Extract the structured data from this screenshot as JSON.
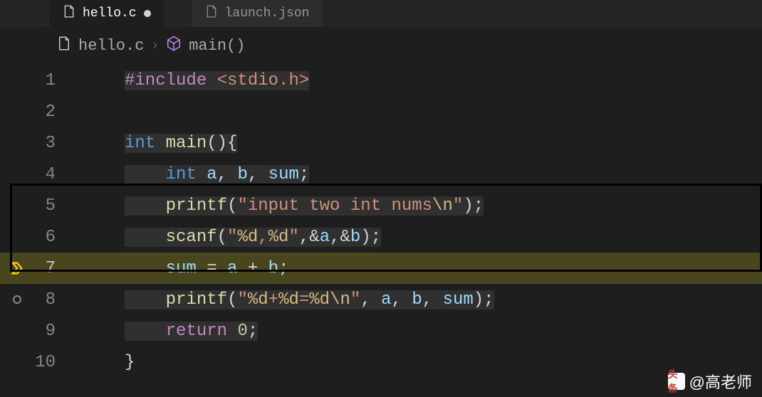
{
  "tabs": [
    {
      "name": "hello.c",
      "active": true,
      "modified": true
    },
    {
      "name": "launch.json",
      "active": false,
      "modified": false
    }
  ],
  "breadcrumbs": {
    "file": "hello.c",
    "symbol": "main()"
  },
  "lines": [
    {
      "num": "1",
      "tokens": [
        {
          "t": "#include",
          "c": "tok-pp"
        },
        {
          "t": " ",
          "c": ""
        },
        {
          "t": "<stdio.h>",
          "c": "tok-inc"
        }
      ]
    },
    {
      "num": "2",
      "tokens": []
    },
    {
      "num": "3",
      "tokens": [
        {
          "t": "int",
          "c": "tok-kw"
        },
        {
          "t": " ",
          "c": ""
        },
        {
          "t": "main",
          "c": "tok-fn"
        },
        {
          "t": "(){",
          "c": "tok-punc"
        }
      ]
    },
    {
      "num": "4",
      "tokens": [
        {
          "t": "    ",
          "c": ""
        },
        {
          "t": "int",
          "c": "tok-kw"
        },
        {
          "t": " ",
          "c": ""
        },
        {
          "t": "a",
          "c": "tok-var"
        },
        {
          "t": ", ",
          "c": "tok-punc"
        },
        {
          "t": "b",
          "c": "tok-var"
        },
        {
          "t": ", ",
          "c": "tok-punc"
        },
        {
          "t": "sum",
          "c": "tok-var"
        },
        {
          "t": ";",
          "c": "tok-punc"
        }
      ]
    },
    {
      "num": "5",
      "tokens": [
        {
          "t": "    ",
          "c": ""
        },
        {
          "t": "printf",
          "c": "tok-fn"
        },
        {
          "t": "(",
          "c": "tok-punc"
        },
        {
          "t": "\"input two int nums",
          "c": "tok-str"
        },
        {
          "t": "\\n",
          "c": "tok-esc"
        },
        {
          "t": "\"",
          "c": "tok-str"
        },
        {
          "t": ");",
          "c": "tok-punc"
        }
      ]
    },
    {
      "num": "6",
      "tokens": [
        {
          "t": "    ",
          "c": ""
        },
        {
          "t": "scanf",
          "c": "tok-fn"
        },
        {
          "t": "(",
          "c": "tok-punc"
        },
        {
          "t": "\"",
          "c": "tok-str"
        },
        {
          "t": "%d",
          "c": "tok-esc"
        },
        {
          "t": ",",
          "c": "tok-str"
        },
        {
          "t": "%d",
          "c": "tok-esc"
        },
        {
          "t": "\"",
          "c": "tok-str"
        },
        {
          "t": ",&",
          "c": "tok-punc"
        },
        {
          "t": "a",
          "c": "tok-var"
        },
        {
          "t": ",&",
          "c": "tok-punc"
        },
        {
          "t": "b",
          "c": "tok-var"
        },
        {
          "t": ");",
          "c": "tok-punc"
        }
      ]
    },
    {
      "num": "7",
      "current": true,
      "gutterIcon": "debug-current",
      "tokens": [
        {
          "t": "    ",
          "c": ""
        },
        {
          "t": "sum",
          "c": "tok-var"
        },
        {
          "t": " = ",
          "c": "tok-op"
        },
        {
          "t": "a",
          "c": "tok-var"
        },
        {
          "t": " + ",
          "c": "tok-op"
        },
        {
          "t": "b",
          "c": "tok-var"
        },
        {
          "t": ";",
          "c": "tok-punc"
        }
      ]
    },
    {
      "num": "8",
      "gutterIcon": "breakpoint-unverified",
      "tokens": [
        {
          "t": "    ",
          "c": ""
        },
        {
          "t": "printf",
          "c": "tok-fn"
        },
        {
          "t": "(",
          "c": "tok-punc"
        },
        {
          "t": "\"",
          "c": "tok-str"
        },
        {
          "t": "%d",
          "c": "tok-esc"
        },
        {
          "t": "+",
          "c": "tok-str"
        },
        {
          "t": "%d",
          "c": "tok-esc"
        },
        {
          "t": "=",
          "c": "tok-str"
        },
        {
          "t": "%d",
          "c": "tok-esc"
        },
        {
          "t": "\\n",
          "c": "tok-esc"
        },
        {
          "t": "\"",
          "c": "tok-str"
        },
        {
          "t": ", ",
          "c": "tok-punc"
        },
        {
          "t": "a",
          "c": "tok-var"
        },
        {
          "t": ", ",
          "c": "tok-punc"
        },
        {
          "t": "b",
          "c": "tok-var"
        },
        {
          "t": ", ",
          "c": "tok-punc"
        },
        {
          "t": "sum",
          "c": "tok-var"
        },
        {
          "t": ");",
          "c": "tok-punc"
        }
      ]
    },
    {
      "num": "9",
      "tokens": [
        {
          "t": "    ",
          "c": ""
        },
        {
          "t": "return",
          "c": "tok-pp"
        },
        {
          "t": " ",
          "c": ""
        },
        {
          "t": "0",
          "c": "tok-num"
        },
        {
          "t": ";",
          "c": "tok-punc"
        }
      ]
    },
    {
      "num": "10",
      "tokens": [
        {
          "t": "}",
          "c": "tok-punc"
        }
      ]
    }
  ],
  "watermark": {
    "logo": "头条",
    "text": "@高老师"
  }
}
